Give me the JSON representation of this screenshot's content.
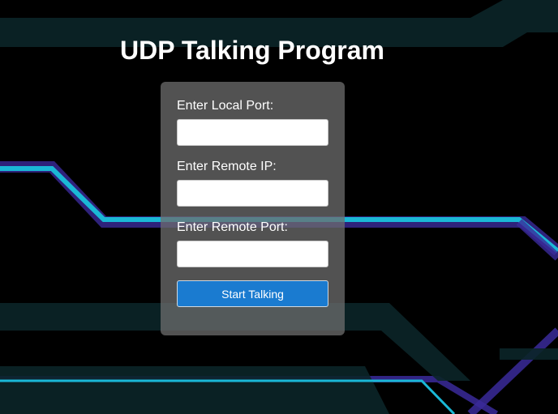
{
  "page": {
    "title": "UDP Talking Program"
  },
  "form": {
    "local_port": {
      "label": "Enter Local Port:",
      "value": "",
      "placeholder": ""
    },
    "remote_ip": {
      "label": "Enter Remote IP:",
      "value": "",
      "placeholder": ""
    },
    "remote_port": {
      "label": "Enter Remote Port:",
      "value": "",
      "placeholder": ""
    },
    "start_button_label": "Start Talking"
  },
  "colors": {
    "background": "#000000",
    "panel": "#6e6e6e",
    "accent_button": "#1a7bd0",
    "circuit_cyan": "#1ab8d6",
    "circuit_purple": "#3a2a9a",
    "circuit_dark": "#0a2a2e"
  }
}
